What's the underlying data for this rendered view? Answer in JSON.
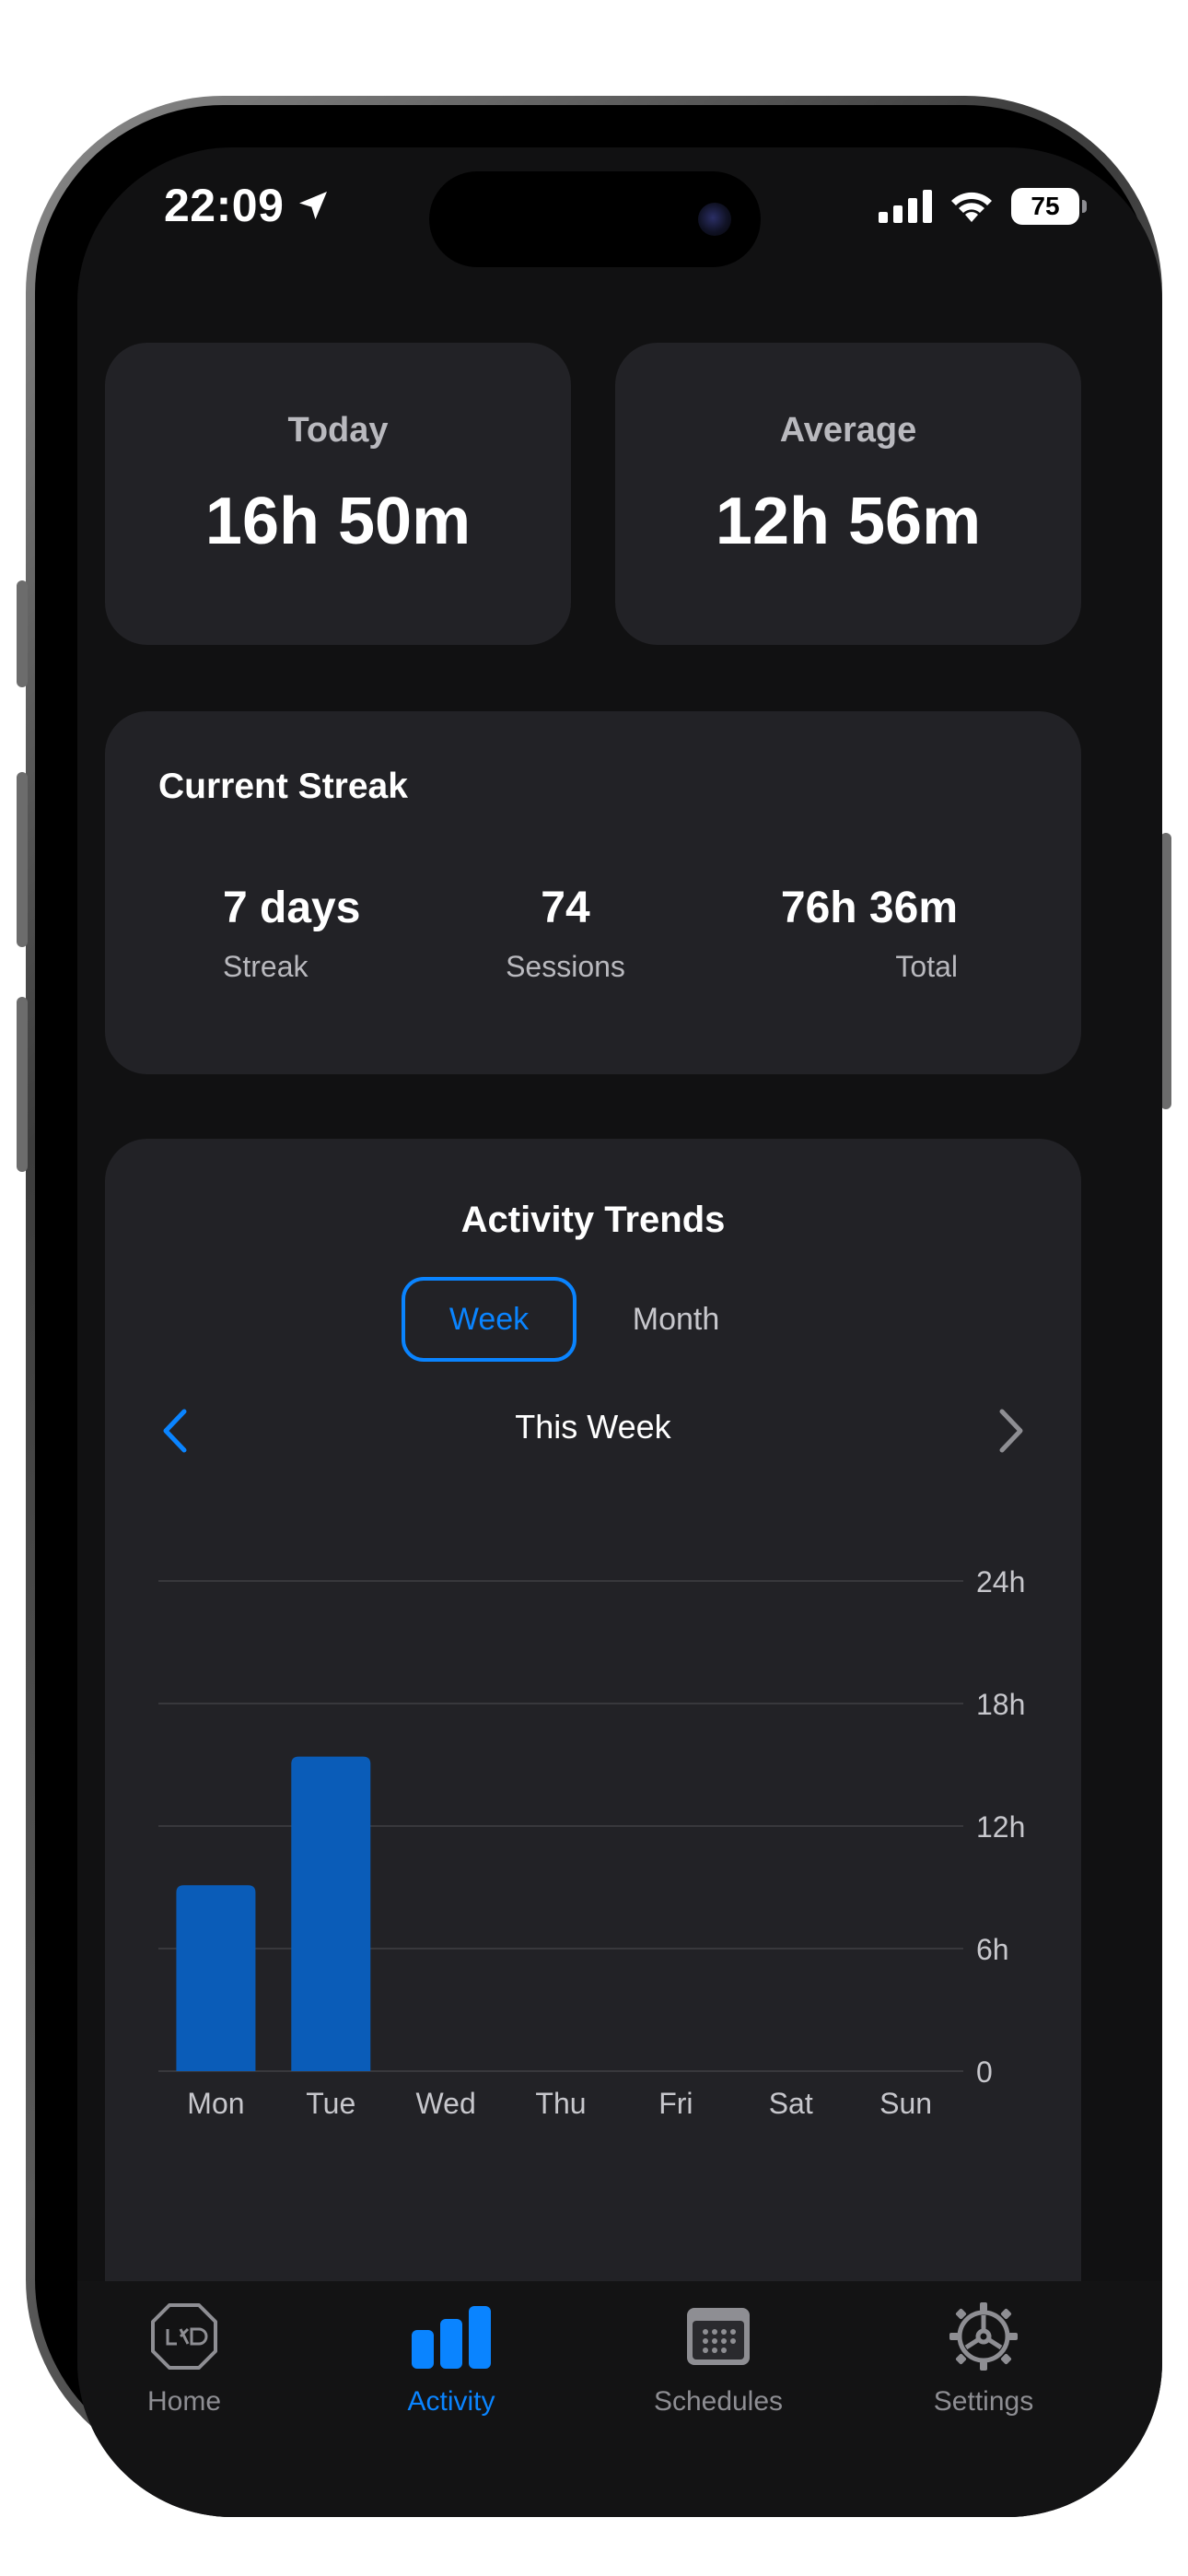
{
  "status_bar": {
    "time": "22:09",
    "battery": "75"
  },
  "summary": {
    "today": {
      "label": "Today",
      "value": "16h 50m"
    },
    "average": {
      "label": "Average",
      "value": "12h 56m"
    }
  },
  "streak": {
    "title": "Current Streak",
    "stats": [
      {
        "value": "7 days",
        "label": "Streak"
      },
      {
        "value": "74",
        "label": "Sessions"
      },
      {
        "value": "76h 36m",
        "label": "Total"
      }
    ]
  },
  "trends": {
    "title": "Activity Trends",
    "segments": {
      "week": "Week",
      "month": "Month"
    },
    "period_label": "This Week"
  },
  "chart_data": {
    "type": "bar",
    "categories": [
      "Mon",
      "Tue",
      "Wed",
      "Thu",
      "Fri",
      "Sat",
      "Sun"
    ],
    "values": [
      9.1,
      15.4,
      0,
      0,
      0,
      0,
      0
    ],
    "y_ticks": [
      "0",
      "6h",
      "12h",
      "18h",
      "24h"
    ],
    "y_tick_values": [
      0,
      6,
      12,
      18,
      24
    ],
    "ylim": [
      0,
      24
    ],
    "grid": true,
    "bar_color": "#0a5cb8",
    "title": "",
    "xlabel": "",
    "ylabel": ""
  },
  "tabbar": {
    "items": [
      {
        "label": "Home",
        "icon": "home-icon"
      },
      {
        "label": "Activity",
        "icon": "bar-chart-icon"
      },
      {
        "label": "Schedules",
        "icon": "calendar-icon"
      },
      {
        "label": "Settings",
        "icon": "gear-icon"
      }
    ],
    "accent": "#0a84ff"
  }
}
